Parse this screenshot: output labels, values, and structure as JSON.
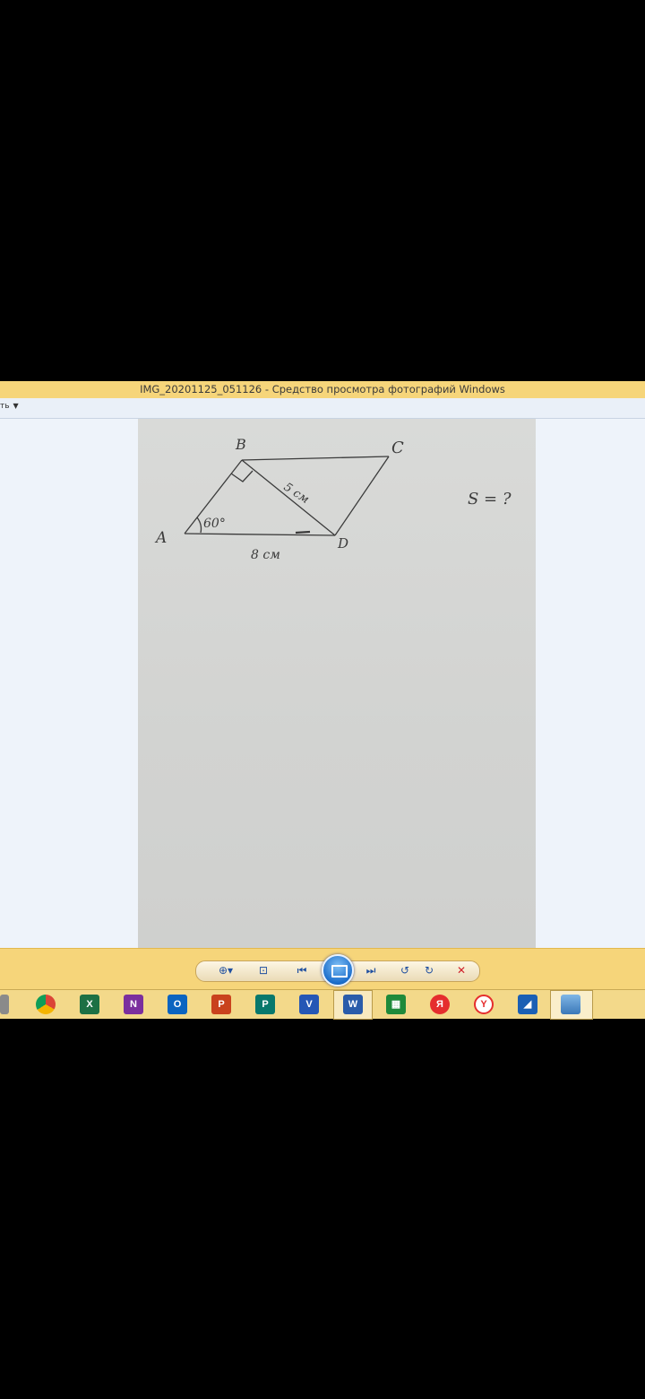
{
  "window": {
    "title": "IMG_20201125_051126 - Средство просмотра фотографий Windows",
    "menu_label": "ть"
  },
  "photo": {
    "labels": {
      "a": "A",
      "b": "B",
      "c": "C",
      "d": "D",
      "angle": "60°",
      "side_bd": "5 см",
      "side_ad": "8 см",
      "question": "S = ?"
    }
  },
  "toolbar": {
    "buttons": [
      "zoom-icon",
      "fit-window-icon",
      "previous-icon",
      "slideshow-icon",
      "next-icon",
      "rotate-ccw-icon",
      "rotate-cw-icon",
      "delete-icon"
    ]
  },
  "taskbar": {
    "apps": [
      "chrome-icon",
      "excel-icon",
      "onenote-icon",
      "outlook-icon",
      "powerpoint-icon",
      "publisher-icon",
      "visio-icon",
      "word-icon",
      "store-icon",
      "yandex-icon",
      "yandex-browser-icon",
      "app-icon",
      "photo-viewer-icon"
    ],
    "letters": {
      "excel": "X",
      "onenote": "N",
      "outlook": "O",
      "powerpoint": "P",
      "publisher": "P",
      "visio": "V",
      "word": "W",
      "yandex": "Я",
      "yandex_browser": "Y"
    }
  }
}
